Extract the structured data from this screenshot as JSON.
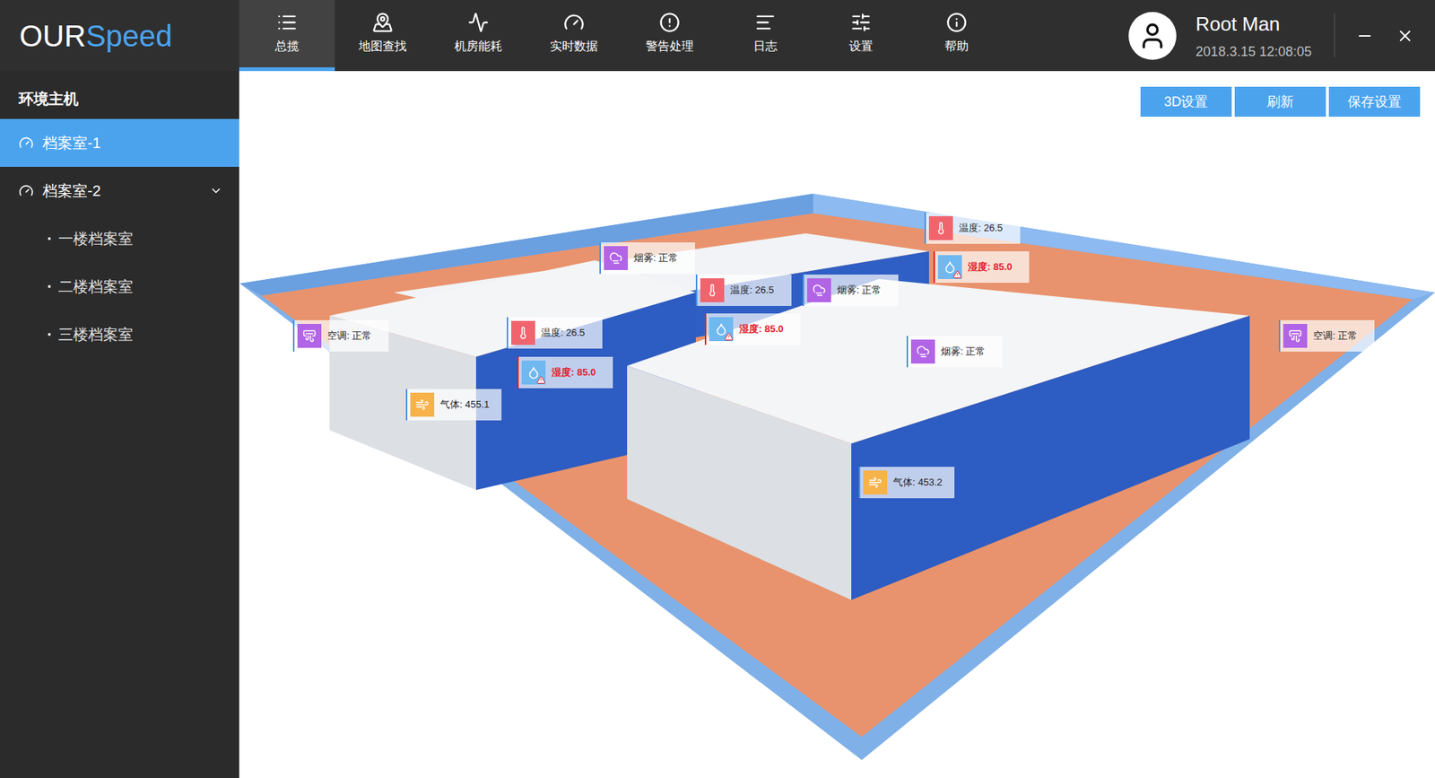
{
  "app": {
    "logo_prefix": "OUR",
    "logo_suffix": "Speed"
  },
  "nav": [
    {
      "label": "总揽",
      "selected": true
    },
    {
      "label": "地图查找",
      "selected": false
    },
    {
      "label": "机房能耗",
      "selected": false
    },
    {
      "label": "实时数据",
      "selected": false
    },
    {
      "label": "警告处理",
      "selected": false
    },
    {
      "label": "日志",
      "selected": false
    },
    {
      "label": "设置",
      "selected": false
    },
    {
      "label": "帮助",
      "selected": false
    }
  ],
  "user": {
    "name": "Root Man",
    "datetime": "2018.3.15 12:08:05"
  },
  "sidebar": {
    "title": "环境主机",
    "items": [
      {
        "label": "档案室-1",
        "selected": true,
        "expanded": false,
        "children": []
      },
      {
        "label": "档案室-2",
        "selected": false,
        "expanded": true,
        "children": [
          {
            "label": "一楼档案室",
            "selected": false
          },
          {
            "label": "二楼档案室",
            "selected": false
          },
          {
            "label": "三楼档案室",
            "selected": false
          }
        ]
      }
    ]
  },
  "toolbar": {
    "buttons": [
      "3D设置",
      "刷新",
      "保存设置"
    ]
  },
  "sensors": [
    {
      "kind": "smoke",
      "label": "烟雾: 正常",
      "alarm": false,
      "color": "#b264e6"
    },
    {
      "kind": "temperature",
      "label": "温度: 26.5",
      "alarm": false,
      "color": "#f0646e"
    },
    {
      "kind": "humidity",
      "label": "湿度: 85.0",
      "alarm": true,
      "color": "#6fb8f0"
    },
    {
      "kind": "temperature",
      "label": "温度: 26.5",
      "alarm": false,
      "color": "#f0646e"
    },
    {
      "kind": "smoke",
      "label": "烟雾: 正常",
      "alarm": false,
      "color": "#b264e6"
    },
    {
      "kind": "humidity",
      "label": "湿度: 85.0",
      "alarm": true,
      "color": "#6fb8f0"
    },
    {
      "kind": "temperature",
      "label": "温度: 26.5",
      "alarm": false,
      "color": "#f0646e"
    },
    {
      "kind": "humidity",
      "label": "湿度: 85.0",
      "alarm": true,
      "color": "#6fb8f0"
    },
    {
      "kind": "aircon",
      "label": "空调: 正常",
      "alarm": false,
      "color": "#b264e6"
    },
    {
      "kind": "gas",
      "label": "气体: 455.1",
      "alarm": false,
      "color": "#f7b24a"
    },
    {
      "kind": "smoke",
      "label": "烟雾: 正常",
      "alarm": false,
      "color": "#b264e6"
    },
    {
      "kind": "aircon",
      "label": "空调: 正常",
      "alarm": false,
      "color": "#b264e6"
    },
    {
      "kind": "gas",
      "label": "气体: 453.2",
      "alarm": false,
      "color": "#f7b24a"
    }
  ]
}
